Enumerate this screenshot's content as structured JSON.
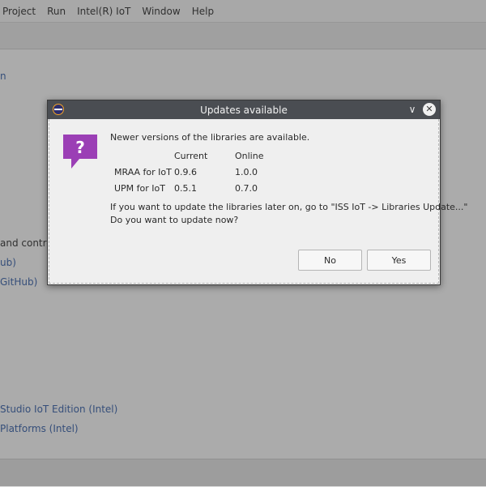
{
  "menubar": {
    "items": [
      "Project",
      "Run",
      "Intel(R) IoT",
      "Window",
      "Help"
    ]
  },
  "background": {
    "text_snippets": [
      "n",
      "and contro",
      "ub)",
      "GitHub)",
      "Studio IoT Edition (Intel)",
      "Platforms (Intel)"
    ]
  },
  "dialog": {
    "title": "Updates available",
    "message": "Newer versions of the libraries are available.",
    "table": {
      "headers": [
        "",
        "Current",
        "Online"
      ],
      "rows": [
        [
          "MRAA for IoT",
          "0.9.6",
          "1.0.0"
        ],
        [
          "UPM for IoT",
          "0.5.1",
          "0.7.0"
        ]
      ]
    },
    "hint_line1": "If you want to update the libraries later on, go to \"ISS IoT -> Libraries Update...\"",
    "hint_line2": "Do you want to update now?",
    "buttons": {
      "no": "No",
      "yes": "Yes"
    },
    "icon_glyph": "?",
    "chevron_glyph": "∨",
    "close_glyph": "✕"
  },
  "colors": {
    "question_icon": "#9b3fb5",
    "titlebar": "#4a4d52",
    "link": "#2a55a0"
  }
}
